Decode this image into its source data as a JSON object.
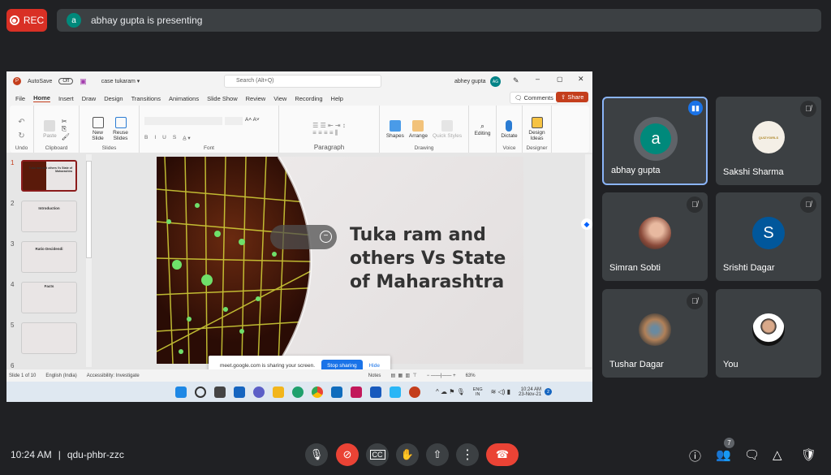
{
  "meet": {
    "rec_label": "REC",
    "presenter_initial": "a",
    "presenting_text": "abhay gupta is presenting",
    "time": "10:24 AM",
    "separator": "|",
    "meeting_code": "qdu-phbr-zzc",
    "people_count": "7",
    "colors": {
      "bg": "#202124",
      "tile": "#3c4043",
      "red": "#ea4335",
      "accent": "#1a73e8"
    },
    "participants": [
      {
        "name": "abhay gupta",
        "initial": "a",
        "avatar_color": "#00897b",
        "speaking": true,
        "muted": false
      },
      {
        "name": "Sakshi Sharma",
        "muted": true,
        "avatar_text": "QUIZYGIRLS"
      },
      {
        "name": "Simran Sobti",
        "muted": true
      },
      {
        "name": "Srishti Dagar",
        "initial": "S",
        "avatar_color": "#01579b",
        "muted": true
      },
      {
        "name": "Tushar Dagar",
        "muted": true
      },
      {
        "name": "You",
        "muted": false
      }
    ],
    "controls": [
      "microphone-icon",
      "camera-off-icon",
      "captions-icon",
      "raise-hand-icon",
      "present-icon",
      "more-options-icon",
      "end-call-icon"
    ],
    "right_controls": [
      "info-icon",
      "people-icon",
      "chat-icon",
      "activities-icon",
      "host-controls-icon"
    ]
  },
  "ppt": {
    "autosave": "AutoSave",
    "autosave_state": "Off",
    "filename": "case tukaram ▾",
    "search_placeholder": "Search (Alt+Q)",
    "user": "abhey gupta",
    "user_initials": "AG",
    "tabs": [
      "File",
      "Home",
      "Insert",
      "Draw",
      "Design",
      "Transitions",
      "Animations",
      "Slide Show",
      "Review",
      "View",
      "Recording",
      "Help"
    ],
    "comments": "Comments",
    "share": "Share",
    "ribbon": {
      "undo": "Undo",
      "paste": "Paste",
      "clipboard": "Clipboard",
      "new_slide": "New Slide",
      "reuse_slides": "Reuse Slides",
      "slides": "Slides",
      "font": "Font",
      "paragraph": "Paragraph",
      "shapes": "Shapes",
      "arrange": "Arrange",
      "quick_styles": "Quick Styles",
      "drawing": "Drawing",
      "editing": "Editing",
      "dictate": "Dictate",
      "voice": "Voice",
      "design_ideas": "Design Ideas",
      "designer": "Designer",
      "bold": "B",
      "italic": "I",
      "underline": "U",
      "strike": "S"
    },
    "thumbnails": [
      {
        "num": "1",
        "title": "Tuka ram and others Vs State of Maharashtra"
      },
      {
        "num": "2",
        "title": "Introduction"
      },
      {
        "num": "3",
        "title": "Ratio Decidendi"
      },
      {
        "num": "4",
        "title": "Facts"
      },
      {
        "num": "5",
        "title": ""
      },
      {
        "num": "6",
        "title": ""
      }
    ],
    "slide_title": "Tuka ram and others Vs State of Maharashtra",
    "share_notice": "meet.google.com is sharing your screen.",
    "stop_sharing": "Stop sharing",
    "hide": "Hide",
    "status": {
      "slide": "Slide 1 of 10",
      "language": "English (India)",
      "accessibility": "Accessibility: Investigate",
      "notes": "Notes",
      "zoom": "63%"
    },
    "tray": {
      "lang1": "ENG",
      "lang2": "IN",
      "time": "10:24 AM",
      "date": "23-Nov-21",
      "badge": "2"
    }
  }
}
